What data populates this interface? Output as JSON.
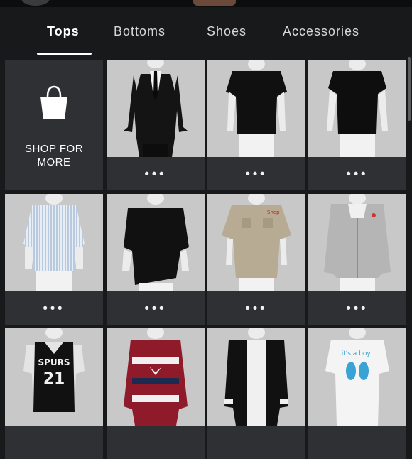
{
  "tabs": [
    {
      "label": "Tops",
      "active": true
    },
    {
      "label": "Bottoms",
      "active": false
    },
    {
      "label": "Shoes",
      "active": false
    },
    {
      "label": "Accessories",
      "active": false
    }
  ],
  "shop": {
    "label_line1": "SHOP FOR",
    "label_line2": "MORE",
    "icon": "shopping-bag-icon"
  },
  "items": [
    {
      "name": "black suit",
      "menu": "•••"
    },
    {
      "name": "black t-shirt",
      "menu": "•••"
    },
    {
      "name": "black t-shirt",
      "menu": "•••"
    },
    {
      "name": "striped button shirt",
      "menu": "•••"
    },
    {
      "name": "black loose sweater",
      "menu": "•••"
    },
    {
      "name": "tan bowling shirt",
      "menu": "•••"
    },
    {
      "name": "grey hoodie",
      "menu": "•••"
    },
    {
      "name": "spurs jersey",
      "jersey_text": "SPURS",
      "jersey_number": "21"
    },
    {
      "name": "christmas sweater"
    },
    {
      "name": "black varsity jacket"
    },
    {
      "name": "footprints tee",
      "tee_text": "it's a boy!"
    }
  ],
  "colors": {
    "background": "#18191b",
    "card": "#2e3033",
    "item_bg": "#c8c8c8",
    "text": "#ffffff"
  }
}
